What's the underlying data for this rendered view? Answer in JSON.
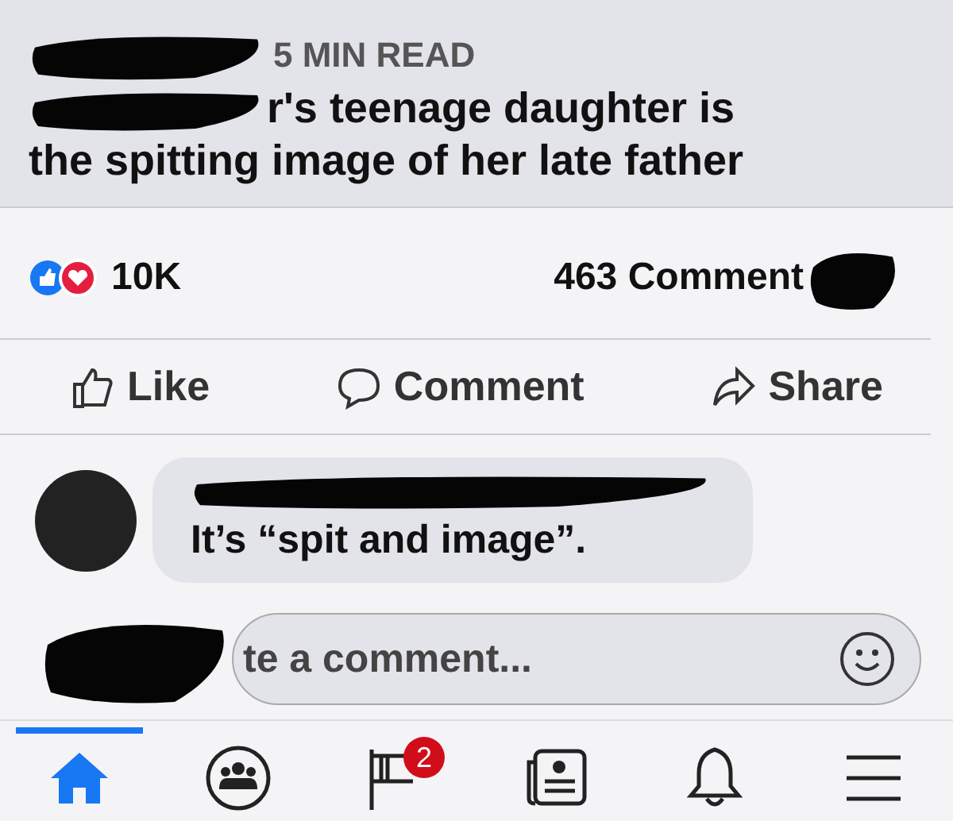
{
  "article": {
    "read_time": "5 MIN READ",
    "title_line_1": "r's teenage daughter is",
    "title_line_2": "the spitting image of her late father"
  },
  "stats": {
    "reactions": "10K",
    "comments": "463 Comment"
  },
  "actions": [
    {
      "kind": "like",
      "label": "Like"
    },
    {
      "kind": "comment",
      "label": "Comment"
    },
    {
      "kind": "share",
      "label": "Share"
    }
  ],
  "comment": {
    "text": "It’s “spit and image”."
  },
  "composer": {
    "placeholder": "te a comment..."
  },
  "nav": [
    {
      "kind": "home",
      "selected": true
    },
    {
      "kind": "groups",
      "selected": false
    },
    {
      "kind": "pages",
      "selected": false,
      "badge": "2"
    },
    {
      "kind": "news",
      "selected": false
    },
    {
      "kind": "bell",
      "selected": false
    },
    {
      "kind": "menu",
      "selected": false
    }
  ]
}
